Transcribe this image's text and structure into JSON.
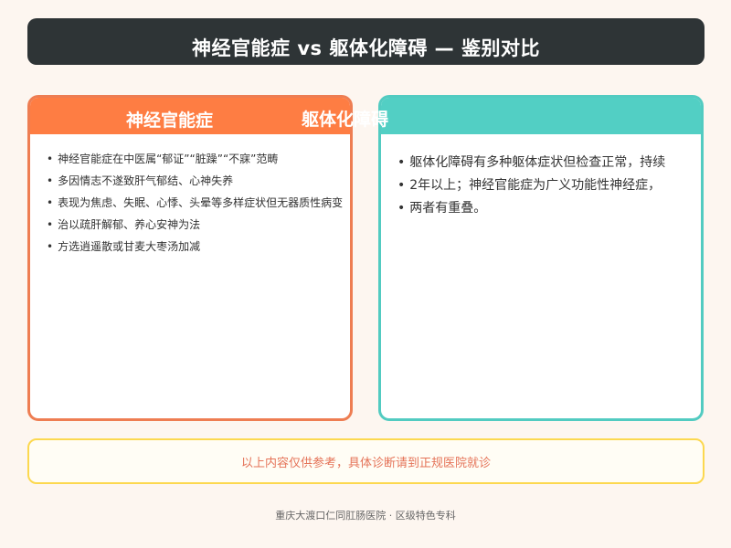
{
  "page": {
    "title": "神经官能症 vs 躯体化障碍 — 鉴别对比",
    "colors": {
      "background": "#fdf6f0",
      "title_bar": "#2e3436",
      "left_accent": "#fe7d43",
      "right_accent": "#52cfc4",
      "note_border": "#fcd84f",
      "note_text": "#e57358"
    }
  },
  "left_card": {
    "heading": "神经官能症",
    "bullet": "•",
    "items": [
      "神经官能症在中医属“郁证”“脏躁”“不寐”范畴",
      "多因情志不遂致肝气郁结、心神失养",
      "表现为焦虑、失眠、心悸、头晕等多样症状但无器质性病变",
      "治以疏肝解郁、养心安神为法",
      "方选逍遥散或甘麦大枣汤加减"
    ]
  },
  "right_card": {
    "heading": "躯体化障碍",
    "bullet": "•",
    "items": [
      "躯体化障碍有多种躯体症状但检查正常，持续",
      "2年以上；神经官能症为广义功能性神经症，",
      "两者有重叠。"
    ]
  },
  "note": {
    "text": "以上内容仅供参考，具体诊断请到正规医院就诊"
  },
  "footer": {
    "text": "重庆大渡口仁同肛肠医院 · 区级特色专科"
  }
}
